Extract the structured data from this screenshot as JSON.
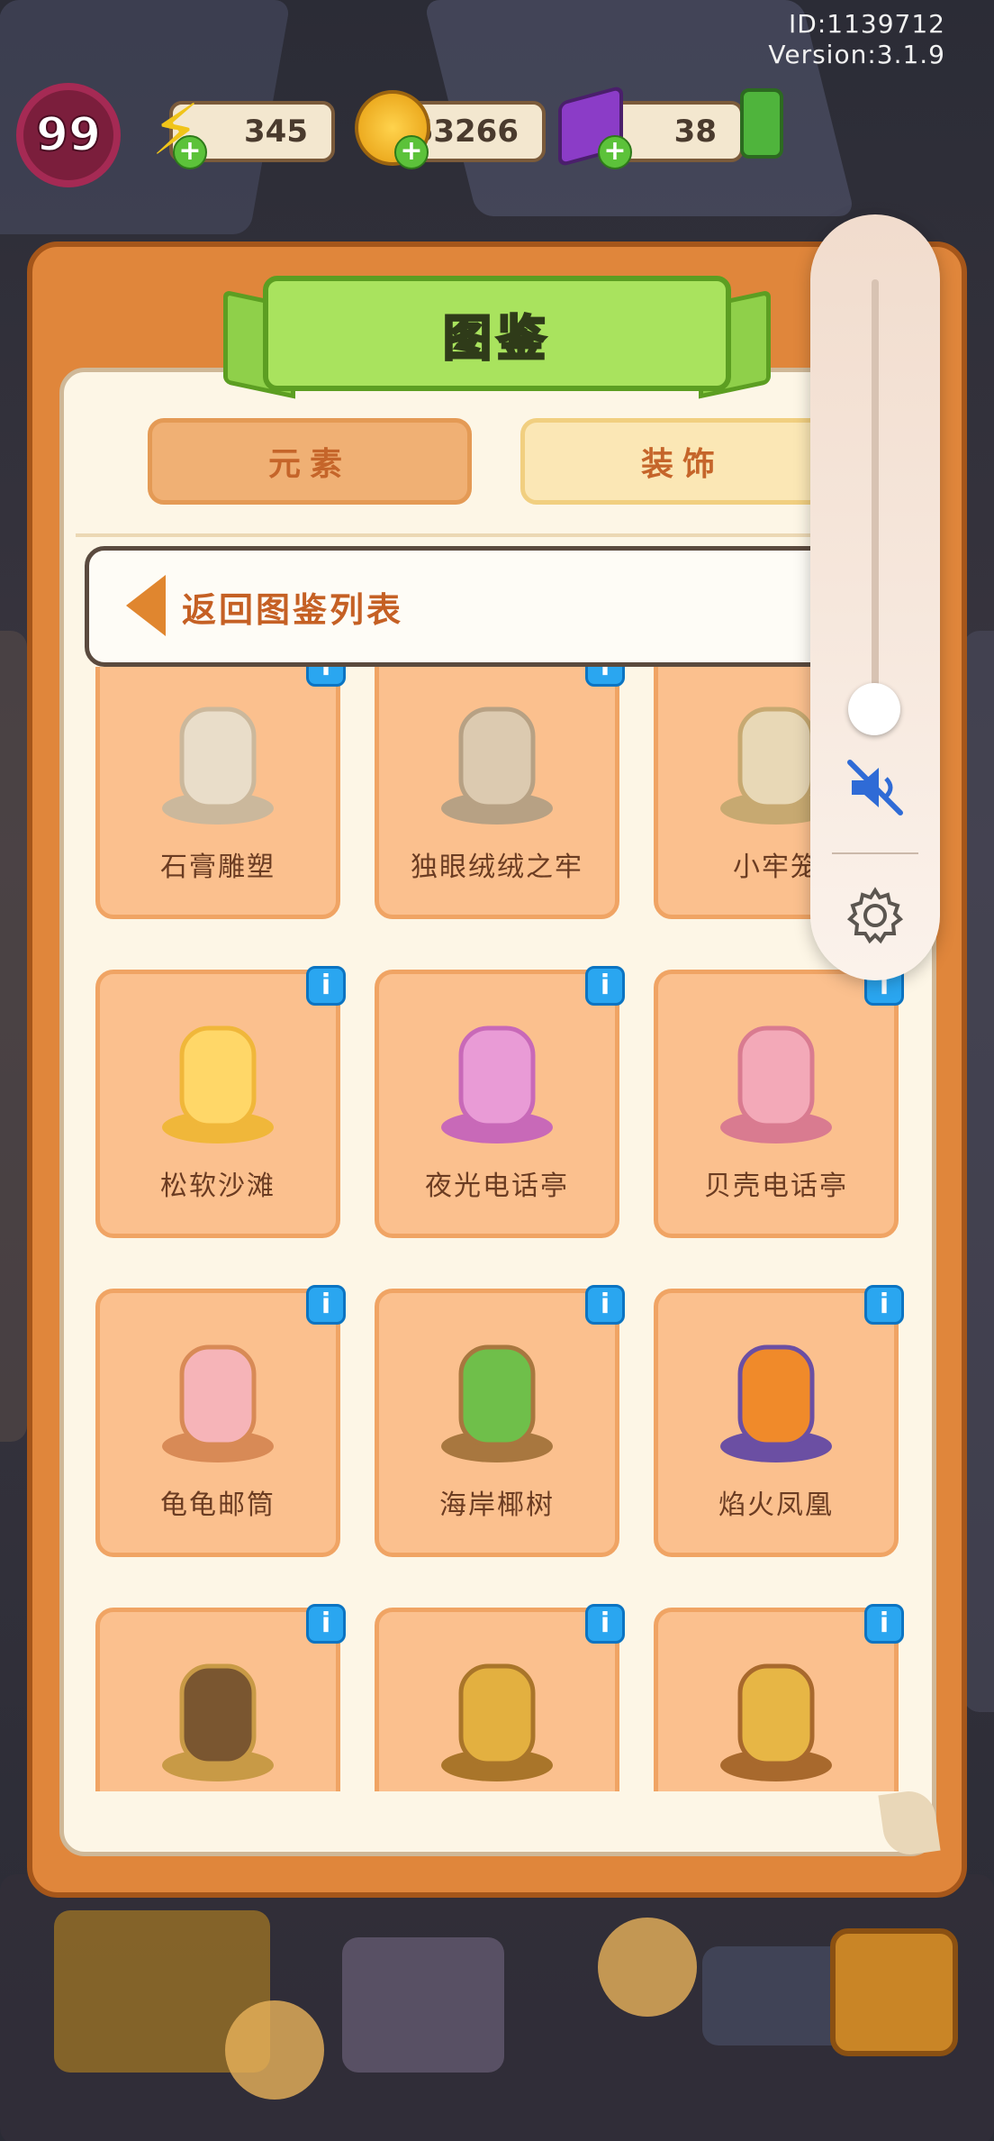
{
  "status": {
    "id_text": "ID:1139712",
    "version_text": "Version:3.1.9"
  },
  "hud": {
    "level": "99",
    "energy": "345",
    "coins": "53266",
    "gems": "38",
    "plus_symbol": "+",
    "accent_colors": {
      "energy": "#f0c419",
      "coin": "#e59b0e",
      "gem": "#8b3cc7"
    }
  },
  "dialog": {
    "title": "图鉴",
    "tabs": [
      {
        "label": "元素"
      },
      {
        "label": "装饰"
      }
    ],
    "back_label": "返回图鉴列表",
    "info_symbol": "i",
    "items": [
      {
        "name": "石膏雕塑",
        "icon": "plaster-statue-icon"
      },
      {
        "name": "独眼绒绒之牢",
        "icon": "stone-cage-icon"
      },
      {
        "name": "小牢笼",
        "icon": "bird-cage-icon"
      },
      {
        "name": "松软沙滩",
        "icon": "sand-patch-icon"
      },
      {
        "name": "夜光电话亭",
        "icon": "glow-phone-booth-icon"
      },
      {
        "name": "贝壳电话亭",
        "icon": "shell-phone-booth-icon"
      },
      {
        "name": "龟龟邮筒",
        "icon": "turtle-mailbox-icon"
      },
      {
        "name": "海岸椰树",
        "icon": "palm-tree-icon"
      },
      {
        "name": "焰火凤凰",
        "icon": "phoenix-perch-icon"
      },
      {
        "name": "",
        "icon": "witch-desk-icon"
      },
      {
        "name": "",
        "icon": "golden-mirror-icon"
      },
      {
        "name": "",
        "icon": "portrait-frame-icon"
      }
    ]
  },
  "volume_panel": {
    "level": 0.0,
    "muted": true,
    "icons": [
      "volume-mute-icon",
      "gear-icon"
    ]
  }
}
